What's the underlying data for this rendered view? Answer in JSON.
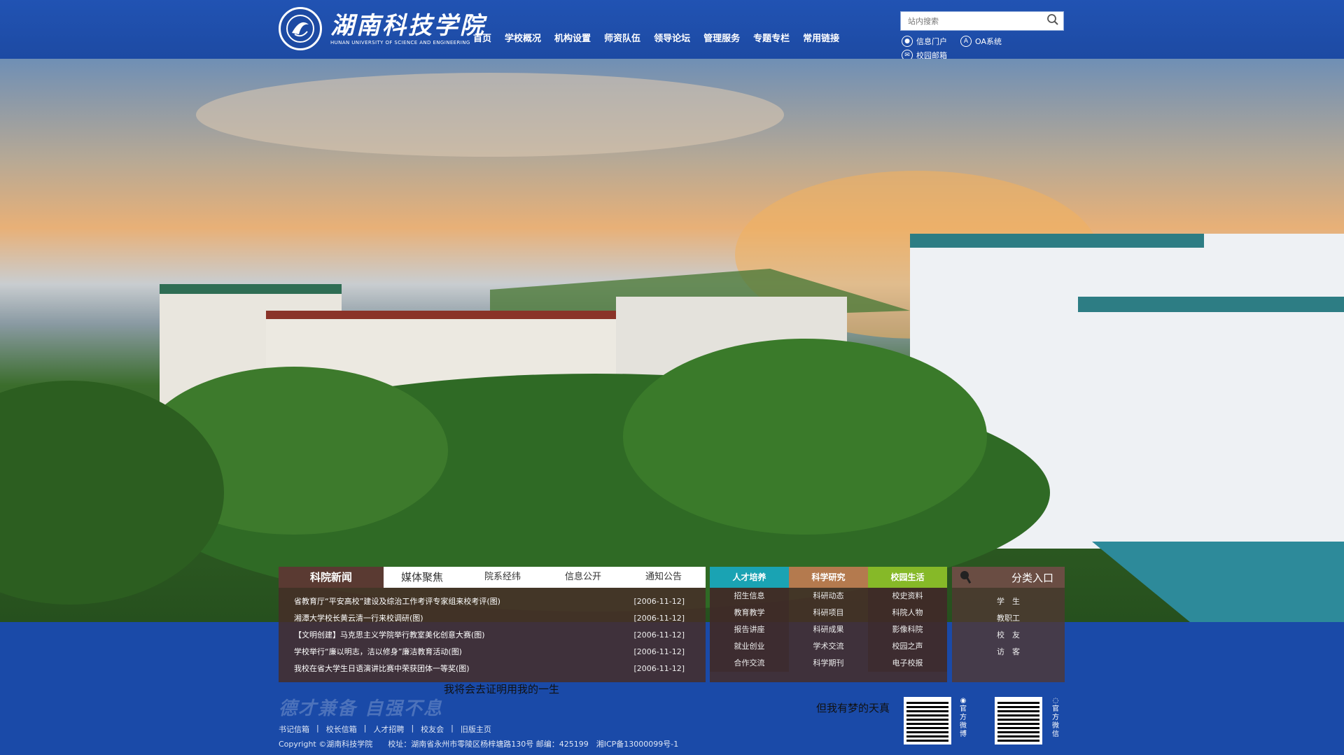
{
  "header": {
    "logo_cn": "湖南科技学院",
    "logo_en": "HUNAN UNIVERSITY OF SCIENCE AND ENGINEERING",
    "nav": [
      "首页",
      "学校概况",
      "机构设置",
      "师资队伍",
      "领导论坛",
      "管理服务",
      "专题专栏",
      "常用链接"
    ],
    "search_placeholder": "站内搜索",
    "quick_links": {
      "info_portal": "信息门户",
      "oa": "OA系统",
      "mail": "校园邮箱"
    }
  },
  "news": {
    "tabs": [
      "科院新闻",
      "媒体聚焦",
      "院系经纬",
      "信息公开",
      "通知公告"
    ],
    "items": [
      {
        "title": "省教育厅“平安高校”建设及综治工作考评专家组来校考评(图)",
        "date": "[2006-11-12]"
      },
      {
        "title": "湘潭大学校长黄云清一行来校调研(图)",
        "date": "[2006-11-12]"
      },
      {
        "title": "【文明创建】马克思主义学院举行教室美化创意大赛(图)",
        "date": "[2006-11-12]"
      },
      {
        "title": "学校举行“廉以明志，洁以修身”廉洁教育活动(图)",
        "date": "[2006-11-12]"
      },
      {
        "title": "我校在省大学生日语演讲比赛中荣获团体一等奖(图)",
        "date": "[2006-11-12]"
      }
    ]
  },
  "categories": [
    {
      "title": "人才培养",
      "color": "#1aa3b3",
      "items": [
        "招生信息",
        "教育教学",
        "报告讲座",
        "就业创业",
        "合作交流"
      ]
    },
    {
      "title": "科学研究",
      "color": "#b47a4e",
      "items": [
        "科研动态",
        "科研项目",
        "科研成果",
        "学术交流",
        "科学期刊"
      ]
    },
    {
      "title": "校园生活",
      "color": "#86b928",
      "items": [
        "校史资料",
        "科院人物",
        "影像科院",
        "校园之声",
        "电子校报"
      ]
    }
  ],
  "entry": {
    "title": "分类入口",
    "items": [
      "学　生",
      "教职工",
      "校　友",
      "访　客"
    ]
  },
  "slogans": {
    "mid": "我将会去证明用我的一生",
    "right": "但我有梦的天真"
  },
  "motto": "德才兼备 自强不息",
  "footer": {
    "links": [
      "书记信箱",
      "校长信箱",
      "人才招聘",
      "校友会",
      "旧版主页"
    ],
    "copyright": "Copyright ©湖南科技学院　　校址：湖南省永州市零陵区杨梓塘路130号 邮编：425199　湘ICP备13000099号-1",
    "qr_weibo": "官方微博",
    "qr_wechat": "官方微信"
  }
}
